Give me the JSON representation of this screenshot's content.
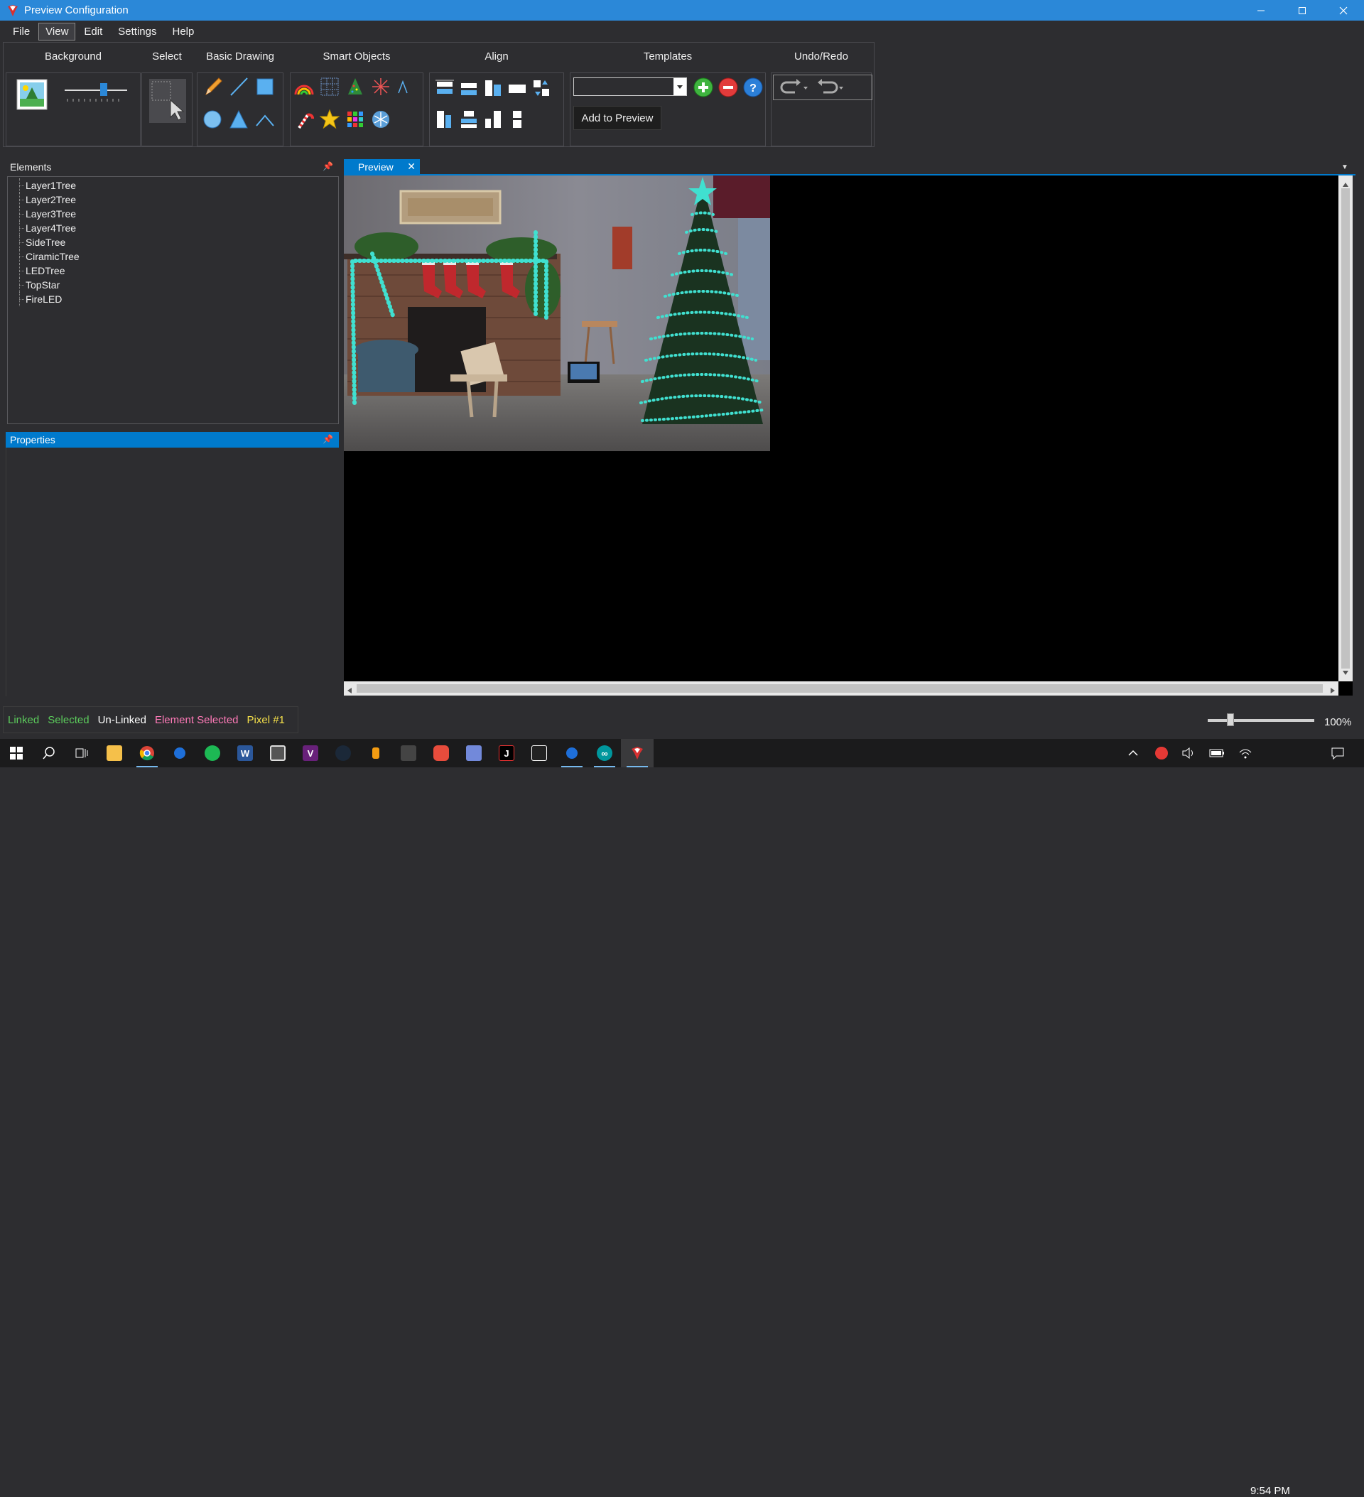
{
  "window": {
    "title": "Preview Configuration",
    "controls": [
      "minimize",
      "maximize",
      "close"
    ]
  },
  "menu": {
    "items": [
      "File",
      "View",
      "Edit",
      "Settings",
      "Help"
    ],
    "active": "View"
  },
  "ribbon": {
    "groups": {
      "background": "Background",
      "select": "Select",
      "basic_drawing": "Basic Drawing",
      "smart_objects": "Smart Objects",
      "align": "Align",
      "templates": "Templates",
      "undo_redo": "Undo/Redo"
    },
    "templates_select_value": "",
    "add_to_preview_label": "Add to Preview",
    "icons": {
      "background": [
        "background-image-icon",
        "brightness-slider"
      ],
      "select": [
        "select-pointer-icon"
      ],
      "basic_drawing": [
        "pencil-icon",
        "line-icon",
        "rectangle-icon",
        "ellipse-icon",
        "triangle-icon",
        "polyline-icon"
      ],
      "smart_objects": [
        "arch-icon",
        "grid-icon",
        "mega-tree-icon",
        "starburst-icon",
        "multi-point-icon",
        "candy-cane-icon",
        "star-icon",
        "matrix-icon",
        "snowflake-icon"
      ],
      "align": [
        "align-top-icon",
        "align-middle-icon",
        "align-bottom-icon",
        "distribute-horizontal-icon",
        "swap-icon",
        "align-left-icon",
        "align-center-icon",
        "align-right-icon",
        "distribute-vertical-icon"
      ],
      "templates": [
        "add-template-icon",
        "remove-template-icon",
        "help-icon"
      ],
      "undo_redo": [
        "undo-icon",
        "redo-icon"
      ]
    }
  },
  "elements_panel": {
    "title": "Elements",
    "items": [
      "Layer1Tree",
      "Layer2Tree",
      "Layer3Tree",
      "Layer4Tree",
      "SideTree",
      "CiramicTree",
      "LEDTree",
      "TopStar",
      "FireLED"
    ]
  },
  "properties_panel": {
    "title": "Properties"
  },
  "document": {
    "tab_label": "Preview",
    "close_glyph": "✕"
  },
  "status": {
    "linked": "Linked",
    "selected": "Selected",
    "unlinked": "Un-Linked",
    "element_selected": "Element Selected",
    "pixel": "Pixel #1",
    "zoom": "100%",
    "colors": {
      "linked": "#5ccc5c",
      "selected": "#5ccc5c",
      "unlinked": "#ffffff",
      "element_selected": "#ff7ab8",
      "pixel": "#f5e04a"
    }
  },
  "taskbar": {
    "time": "9:54 PM",
    "apps": [
      "start-icon",
      "search-icon",
      "task-view-icon",
      "file-explorer-icon",
      "chrome-icon",
      "maps-icon",
      "spotify-icon",
      "word-icon",
      "camera-icon",
      "visual-studio-icon",
      "steam-icon",
      "app-icon",
      "app-icon",
      "app-icon",
      "discord-icon",
      "jetbrains-icon",
      "unity-icon",
      "maps-icon",
      "arduino-icon",
      "vixen-icon"
    ]
  },
  "colors": {
    "accent": "#007acc",
    "title_bar": "#2b88d8",
    "background": "#2d2d30",
    "led": "#40e0d0"
  }
}
